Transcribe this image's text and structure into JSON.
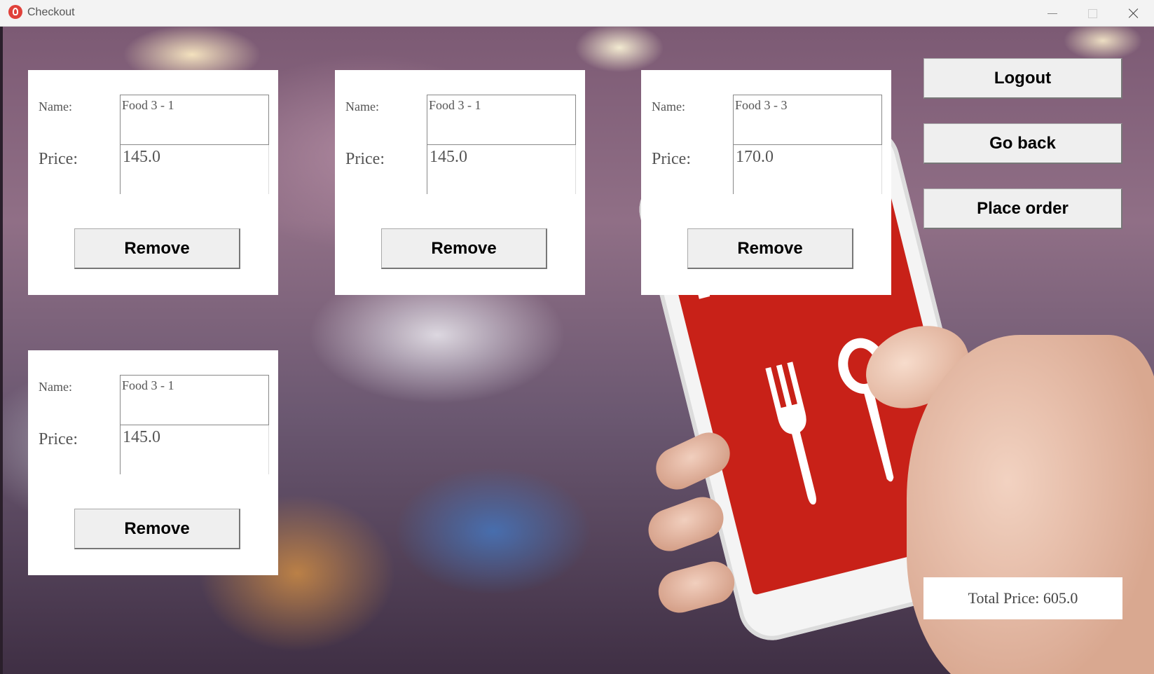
{
  "window": {
    "title": "Checkout"
  },
  "labels": {
    "name": "Name:",
    "price": "Price:"
  },
  "items": [
    {
      "name": "Food 3 - 1",
      "price": "145.0",
      "remove_label": "Remove"
    },
    {
      "name": "Food 3 - 1",
      "price": "145.0",
      "remove_label": "Remove"
    },
    {
      "name": "Food 3 - 3",
      "price": "170.0",
      "remove_label": "Remove"
    },
    {
      "name": "Food 3 - 1",
      "price": "145.0",
      "remove_label": "Remove"
    }
  ],
  "actions": {
    "logout": "Logout",
    "go_back": "Go back",
    "place_order": "Place order"
  },
  "total_label": "Total Price: 605.0",
  "background": {
    "phone_word": "Food",
    "screen_color": "#c2231a"
  }
}
